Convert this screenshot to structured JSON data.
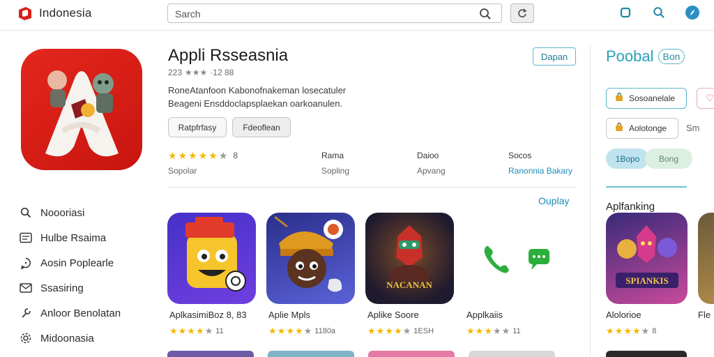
{
  "header": {
    "brand": "Indonesia",
    "search_placeholder": "Sarch",
    "icons": [
      "search-icon",
      "refresh-icon",
      "square-icon",
      "search-icon",
      "compass-icon"
    ]
  },
  "app": {
    "title": "Appli Rsseasnia",
    "rating_count": "223",
    "meta_tail": "·12 88",
    "description_line1": "RoneAtanfoon Kabonofnakeman losecatuler",
    "description_line2": "Beageni Ensddoclapsplaekan oarkoanulen.",
    "button_1": "Ratpfrfasy",
    "button_2": "Fdeoflean",
    "open_label": "Dapan",
    "stats": [
      {
        "label": "",
        "sub": "Sopolar",
        "rating": 4.5,
        "value": "8"
      },
      {
        "label": "Rama",
        "sub": "Sopling"
      },
      {
        "label": "Daioo",
        "sub": "Apvang"
      },
      {
        "label": "Socos",
        "sub": "Ranonnia Bakary"
      }
    ],
    "display_link": "Ouplay"
  },
  "nav": [
    {
      "label": "Noooriasi",
      "icon": "search-icon"
    },
    {
      "label": "Hulbe Rsaima",
      "icon": "grid-icon"
    },
    {
      "label": "Aosin Poplearle",
      "icon": "chat-icon"
    },
    {
      "label": "Ssasiring",
      "icon": "mail-icon"
    },
    {
      "label": "Anloor Benolatan",
      "icon": "tool-icon"
    },
    {
      "label": "Midoonasia",
      "icon": "gear-icon"
    }
  ],
  "apps": [
    {
      "name": "AplkasimiBoz 8, 83",
      "rating": 4.5,
      "count": "11",
      "icon": "emoji-game-icon"
    },
    {
      "name": "Aplie Mpls",
      "rating": 4.5,
      "count": "1180a",
      "icon": "warrior-game-icon"
    },
    {
      "name": "Aplike Soore",
      "rating": 4.5,
      "count": "1ESH",
      "icon": "nacanan-game-icon"
    },
    {
      "name": "Applkaiis",
      "rating": 3.5,
      "count": "11",
      "icon": "phone-chat-icon"
    }
  ],
  "panel": {
    "title": "Poobal",
    "badge": "Bon",
    "buttons": [
      {
        "label": "Sosoanelale",
        "icon": "bag-icon"
      },
      {
        "label": "Aolotonge",
        "icon": "bag-icon",
        "extra": "Sm"
      }
    ],
    "pills": [
      "1Bopo",
      "Bong"
    ],
    "section_heading": "Aplfanking",
    "featured": {
      "name": "Alolorioe",
      "rating": 4.5,
      "count": "8",
      "title_art": "SPIANKIS"
    },
    "peek_name": "Fle"
  },
  "hero_art_text": "NACANAN",
  "colors": {
    "accent": "#2aa0b8",
    "star": "#f2b800",
    "brand_red": "#d8201a"
  }
}
